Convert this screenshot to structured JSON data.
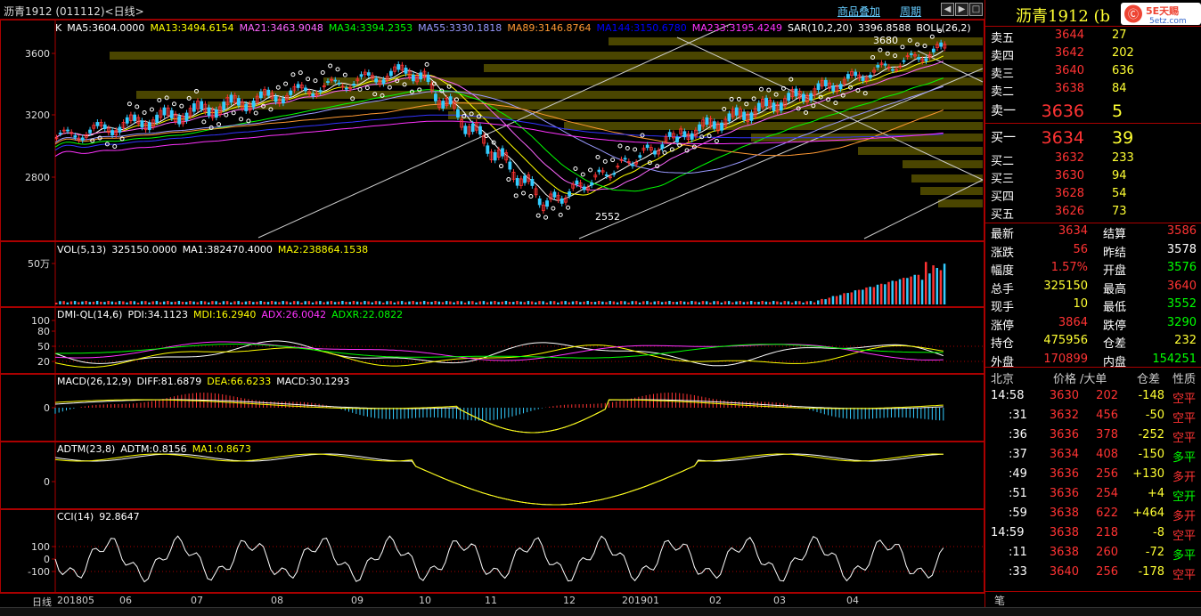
{
  "window": {
    "title": "沥青1912 (011112)<日线>",
    "btn_overlay": "商品叠加",
    "btn_period": "周期",
    "tool_icons": [
      "arrow-left-icon",
      "arrow-right-icon",
      "box-icon",
      "close-icon"
    ]
  },
  "main_pane": {
    "ma_labels": [
      {
        "text": "K",
        "color": "#ffffff"
      },
      {
        "text": "MA5:3604.0000",
        "color": "#ffffff"
      },
      {
        "text": "MA13:3494.6154",
        "color": "#ffff00"
      },
      {
        "text": "MA21:3463.9048",
        "color": "#ff66ff"
      },
      {
        "text": "MA34:3394.2353",
        "color": "#00ff00"
      },
      {
        "text": "MA55:3330.1818",
        "color": "#9999ff"
      },
      {
        "text": "MA89:3146.8764",
        "color": "#ff9933"
      },
      {
        "text": "MA144:3150.6780",
        "color": "#0000ff"
      },
      {
        "text": "MA233:3195.4249",
        "color": "#ff33ff"
      },
      {
        "text": "SAR(10,2,20)",
        "color": "#ffffff"
      },
      {
        "text": "3396.8588",
        "color": "#ffffff"
      },
      {
        "text": "BOLL(26,2)",
        "color": "#ffffff"
      }
    ],
    "y_ticks": [
      "3600",
      "3200",
      "2800"
    ],
    "high_marker": "3680",
    "low_marker": "2552"
  },
  "vol_pane": {
    "labels": [
      {
        "text": "VOL(5,13)",
        "color": "#ffffff"
      },
      {
        "text": "325150.0000",
        "color": "#ffffff"
      },
      {
        "text": "MA1:382470.4000",
        "color": "#ffffff"
      },
      {
        "text": "MA2:238864.1538",
        "color": "#ffff00"
      }
    ],
    "y_tick": "50万"
  },
  "dmi_pane": {
    "labels": [
      {
        "text": "DMI-QL(14,6)",
        "color": "#ffffff"
      },
      {
        "text": "PDI:34.1123",
        "color": "#ffffff"
      },
      {
        "text": "MDI:16.2940",
        "color": "#ffff00"
      },
      {
        "text": "ADX:26.0042",
        "color": "#ff33ff"
      },
      {
        "text": "ADXR:22.0822",
        "color": "#00ff00"
      }
    ],
    "y_ticks": [
      "100",
      "80",
      "50",
      "20"
    ]
  },
  "macd_pane": {
    "labels": [
      {
        "text": "MACD(26,12,9)",
        "color": "#ffffff"
      },
      {
        "text": "DIFF:81.6879",
        "color": "#ffffff"
      },
      {
        "text": "DEA:66.6233",
        "color": "#ffff00"
      },
      {
        "text": "MACD:30.1293",
        "color": "#ffffff"
      }
    ],
    "y_tick": "0"
  },
  "adtm_pane": {
    "labels": [
      {
        "text": "ADTM(23,8)",
        "color": "#ffffff"
      },
      {
        "text": "ADTM:0.8156",
        "color": "#ffffff"
      },
      {
        "text": "MA1:0.8673",
        "color": "#ffff00"
      }
    ],
    "y_tick": "0"
  },
  "cci_pane": {
    "labels": [
      {
        "text": "CCI(14)",
        "color": "#ffffff"
      },
      {
        "text": "92.8647",
        "color": "#ffffff"
      }
    ],
    "y_ticks": [
      "100",
      "0",
      "-100"
    ]
  },
  "date_axis": {
    "period_label": "日线",
    "dates": [
      "201805",
      "06",
      "07",
      "08",
      "09",
      "10",
      "11",
      "12",
      "201901",
      "02",
      "03",
      "04"
    ]
  },
  "quote": {
    "name": "沥青1912 (b",
    "logo_text": "5E天赐",
    "logo_sub": "5etz.com",
    "asks": [
      {
        "label": "卖五",
        "price": "3644",
        "vol": "27"
      },
      {
        "label": "卖四",
        "price": "3642",
        "vol": "202"
      },
      {
        "label": "卖三",
        "price": "3640",
        "vol": "636"
      },
      {
        "label": "卖二",
        "price": "3638",
        "vol": "84"
      },
      {
        "label": "卖一",
        "price": "3636",
        "vol": "5"
      }
    ],
    "bids": [
      {
        "label": "买一",
        "price": "3634",
        "vol": "39"
      },
      {
        "label": "买二",
        "price": "3632",
        "vol": "233"
      },
      {
        "label": "买三",
        "price": "3630",
        "vol": "94"
      },
      {
        "label": "买四",
        "price": "3628",
        "vol": "54"
      },
      {
        "label": "买五",
        "price": "3626",
        "vol": "73"
      }
    ],
    "stats": [
      {
        "l1": "最新",
        "v1": "3634",
        "c1": "#ff3333",
        "l2": "结算",
        "v2": "3586",
        "c2": "#ff3333"
      },
      {
        "l1": "涨跌",
        "v1": "56",
        "c1": "#ff3333",
        "l2": "昨结",
        "v2": "3578",
        "c2": "#ffffff"
      },
      {
        "l1": "幅度",
        "v1": "1.57%",
        "c1": "#ff3333",
        "l2": "开盘",
        "v2": "3576",
        "c2": "#00ff00"
      },
      {
        "l1": "总手",
        "v1": "325150",
        "c1": "#ffff33",
        "l2": "最高",
        "v2": "3640",
        "c2": "#ff3333"
      },
      {
        "l1": "现手",
        "v1": "10",
        "c1": "#ffff33",
        "l2": "最低",
        "v2": "3552",
        "c2": "#00ff00"
      },
      {
        "l1": "涨停",
        "v1": "3864",
        "c1": "#ff3333",
        "l2": "跌停",
        "v2": "3290",
        "c2": "#00ff00"
      },
      {
        "l1": "持仓",
        "v1": "475956",
        "c1": "#ffff33",
        "l2": "仓差",
        "v2": "232",
        "c2": "#ffff33"
      },
      {
        "l1": "外盘",
        "v1": "170899",
        "c1": "#ff3333",
        "l2": "内盘",
        "v2": "154251",
        "c2": "#00ff00"
      }
    ],
    "tick_header": {
      "c1": "北京",
      "c2": "价格",
      "c3": "/大单",
      "c4": "仓差",
      "c5": "性质"
    },
    "ticks": [
      {
        "time": "14:58",
        "price": "3630",
        "vol": "202",
        "diff": "-148",
        "diff_color": "#ffff33",
        "type": "空平",
        "type_color": "#ff3333"
      },
      {
        "time": ":31",
        "price": "3632",
        "vol": "456",
        "diff": "-50",
        "diff_color": "#ffff33",
        "type": "空平",
        "type_color": "#ff3333"
      },
      {
        "time": ":36",
        "price": "3636",
        "vol": "378",
        "diff": "-252",
        "diff_color": "#ffff33",
        "type": "空平",
        "type_color": "#ff3333"
      },
      {
        "time": ":37",
        "price": "3634",
        "vol": "408",
        "diff": "-150",
        "diff_color": "#ffff33",
        "type": "多平",
        "type_color": "#00ff00"
      },
      {
        "time": ":49",
        "price": "3636",
        "vol": "256",
        "diff": "+130",
        "diff_color": "#ffff33",
        "type": "多开",
        "type_color": "#ff3333"
      },
      {
        "time": ":51",
        "price": "3636",
        "vol": "254",
        "diff": "+4",
        "diff_color": "#ffff33",
        "type": "空开",
        "type_color": "#00ff00"
      },
      {
        "time": ":59",
        "price": "3638",
        "vol": "622",
        "diff": "+464",
        "diff_color": "#ffff33",
        "type": "多开",
        "type_color": "#ff3333"
      },
      {
        "time": "14:59",
        "price": "3638",
        "vol": "218",
        "diff": "-8",
        "diff_color": "#ffff33",
        "type": "空平",
        "type_color": "#ff3333"
      },
      {
        "time": ":11",
        "price": "3638",
        "vol": "260",
        "diff": "-72",
        "diff_color": "#ffff33",
        "type": "多平",
        "type_color": "#00ff00"
      },
      {
        "time": ":33",
        "price": "3640",
        "vol": "256",
        "diff": "-178",
        "diff_color": "#ffff33",
        "type": "空平",
        "type_color": "#ff3333"
      }
    ],
    "footer_tab": "笔"
  }
}
